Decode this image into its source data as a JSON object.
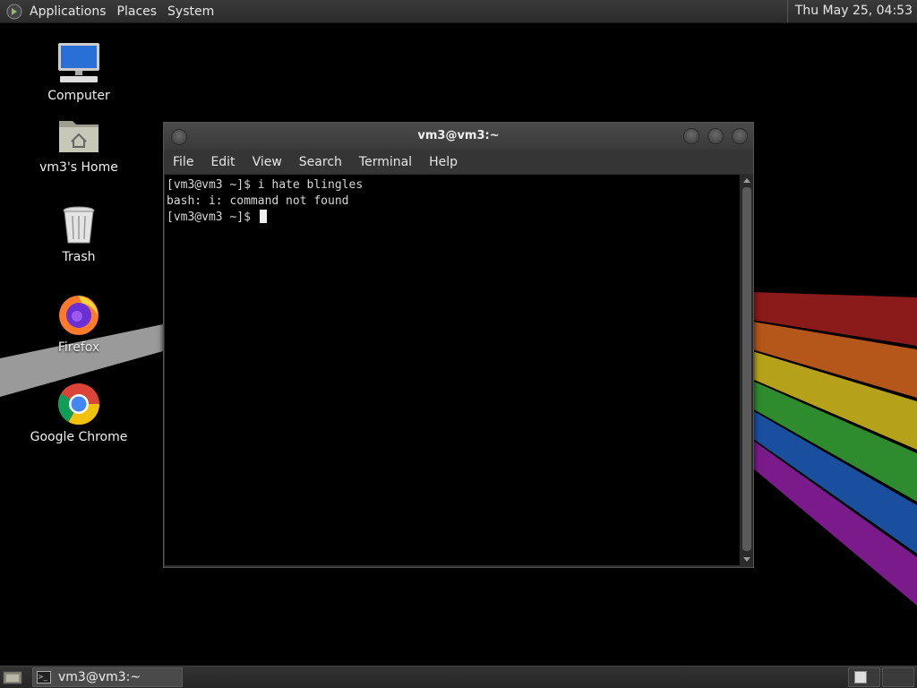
{
  "top_panel": {
    "menus": [
      "Applications",
      "Places",
      "System"
    ],
    "clock": "Thu May 25, 04:53"
  },
  "desktop_icons": [
    {
      "label": "Computer",
      "icon": "computer-icon"
    },
    {
      "label": "vm3's Home",
      "icon": "home-folder-icon"
    },
    {
      "label": "Trash",
      "icon": "trash-icon"
    },
    {
      "label": "Firefox",
      "icon": "firefox-icon"
    },
    {
      "label": "Google Chrome",
      "icon": "chrome-icon"
    }
  ],
  "terminal": {
    "title": "vm3@vm3:~",
    "menus": [
      "File",
      "Edit",
      "View",
      "Search",
      "Terminal",
      "Help"
    ],
    "lines": [
      "[vm3@vm3 ~]$ i hate blingles",
      "bash: i: command not found",
      "[vm3@vm3 ~]$ "
    ]
  },
  "taskbar": {
    "task_label": "vm3@vm3:~"
  },
  "colors": {
    "rainbow": [
      "#8b1a1a",
      "#b5561a",
      "#b5a21a",
      "#2e8b2e",
      "#1a4fa0",
      "#7a1a8b"
    ]
  }
}
